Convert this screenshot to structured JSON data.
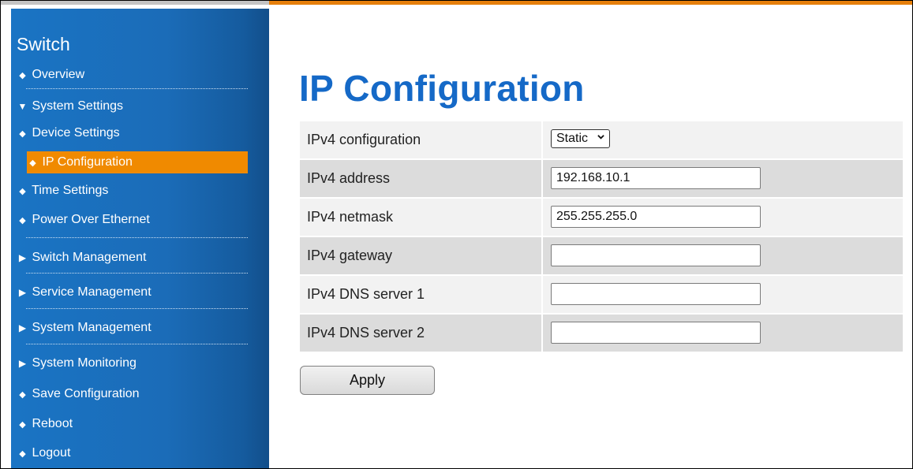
{
  "sidebar": {
    "title": "Switch",
    "items": {
      "overview": {
        "label": "Overview",
        "glyph": "◆"
      },
      "system_settings": {
        "label": "System Settings",
        "glyph": "▼"
      },
      "device_settings": {
        "label": "Device Settings",
        "glyph": "◆"
      },
      "ip_configuration": {
        "label": "IP Configuration",
        "glyph": "◆"
      },
      "time_settings": {
        "label": "Time Settings",
        "glyph": "◆"
      },
      "power_over_ethernet": {
        "label": "Power Over Ethernet",
        "glyph": "◆"
      },
      "switch_management": {
        "label": "Switch Management",
        "glyph": "▶"
      },
      "service_management": {
        "label": "Service Management",
        "glyph": "▶"
      },
      "system_management": {
        "label": "System Management",
        "glyph": "▶"
      },
      "system_monitoring": {
        "label": "System Monitoring",
        "glyph": "▶"
      },
      "save_configuration": {
        "label": "Save Configuration",
        "glyph": "◆"
      },
      "reboot": {
        "label": "Reboot",
        "glyph": "◆"
      },
      "logout": {
        "label": "Logout",
        "glyph": "◆"
      }
    },
    "active_item": "IP Configuration"
  },
  "main": {
    "title": "IP Configuration",
    "fields": {
      "ipv4_configuration": {
        "label": "IPv4 configuration",
        "value": "Static"
      },
      "ipv4_address": {
        "label": "IPv4 address",
        "value": "192.168.10.1"
      },
      "ipv4_netmask": {
        "label": "IPv4 netmask",
        "value": "255.255.255.0"
      },
      "ipv4_gateway": {
        "label": "IPv4 gateway",
        "value": ""
      },
      "ipv4_dns1": {
        "label": "IPv4 DNS server 1",
        "value": ""
      },
      "ipv4_dns2": {
        "label": "IPv4 DNS server 2",
        "value": ""
      }
    },
    "apply_label": "Apply"
  },
  "colors": {
    "accent_orange": "#f08a00",
    "sidebar_blue": "#1a74c4",
    "title_blue": "#1569c7"
  },
  "icons": {
    "bullet": "diamond-bullet-icon",
    "expanded": "triangle-down-icon",
    "collapsed": "triangle-right-icon",
    "select": "chevron-down-icon"
  }
}
